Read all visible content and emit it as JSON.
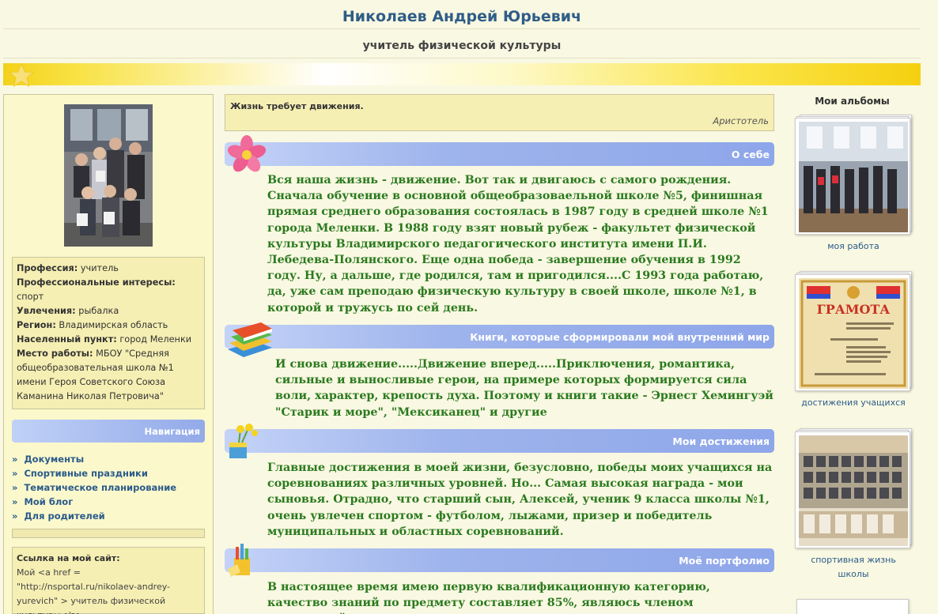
{
  "header": {
    "name": "Николаев Андрей Юрьевич",
    "profession_title": "учитель физической культуры"
  },
  "profile": {
    "items": [
      {
        "label": "Профессия:",
        "value": " учитель"
      },
      {
        "label": "Профессиональные интересы:",
        "value": " спорт"
      },
      {
        "label": "Увлечения:",
        "value": " рыбалка"
      },
      {
        "label": "Регион:",
        "value": " Владимирская область"
      },
      {
        "label": "Населенный пункт:",
        "value": " город Меленки"
      },
      {
        "label": "Место работы:",
        "value": " МБОУ \"Средняя общеобразовательная школа №1 имени Героя Советского Союза Каманина Николая Петровича\""
      }
    ]
  },
  "navigation": {
    "title": "Навигация",
    "items": [
      "Документы",
      "Спортивные праздники",
      "Тематическое планирование",
      "Мой блог",
      "Для родителей"
    ]
  },
  "site_link": {
    "title": "Ссылка на мой сайт:",
    "code": "Мой <a href = \"http://nsportal.ru/nikolaev-andrey-yurevich\" > учитель физической культуры</a>"
  },
  "quote": {
    "text": "Жизнь требует движения.",
    "author": "Аристотель"
  },
  "sections": [
    {
      "title": "О себе",
      "text": "Вся наша жизнь - движение. Вот так и двигаюсь с самого рождения. Сначала обучение в основной общеобразоваельной школе №5, финишная прямая среднего образования состоялась в 1987 году в средней школе №1 города Меленки. В 1988 году взят новый рубеж - факультет физической культуры Владимирского педагогического  института имени П.И. Лебедева-Полянского. Еще одна победа - завершение обучения в 1992 году. Ну, а дальше, где родился, там и пригодился....С 1993 года работаю, да, уже сам преподаю физическую культуру в своей школе, школе №1, в которой и тружусь по сей день."
    },
    {
      "title": "Книги, которые сформировали мой внутренний мир",
      "text": "И снова движение.....Движение вперед.....Приключения, романтика, сильные и выносливые герои, на примере которых формируется сила воли, характер, крепость духа. Поэтому и книги такие  - Эрнест Хемингуэй \"Старик и море\", \"Мексиканец\" и другие"
    },
    {
      "title": "Мои достижения",
      "text": "Главные достижения в моей жизни, безусловно, победы моих учащихся на соревнованиях различных уровней. Но... Самая высокая награда - мои сыновья. Отрадно, что старший сын, Алексей, ученик 9 класса школы №1, очень увлечен спортом - футболом, лыжами, призер и победитель муниципальных и областных соревнований."
    },
    {
      "title": "Моё портфолио",
      "text": "В настоящее время имею первую квалификационную категорию, качество знаний по предмету составляет 85%, являюсь членом предметной комиссии"
    }
  ],
  "albums": {
    "title": "Мои альбомы",
    "items": [
      {
        "caption": "моя работа"
      },
      {
        "caption": "достижения учащихся",
        "photo_text": "ГРАМОТА"
      },
      {
        "caption": "спортивная жизнь школы"
      }
    ]
  }
}
